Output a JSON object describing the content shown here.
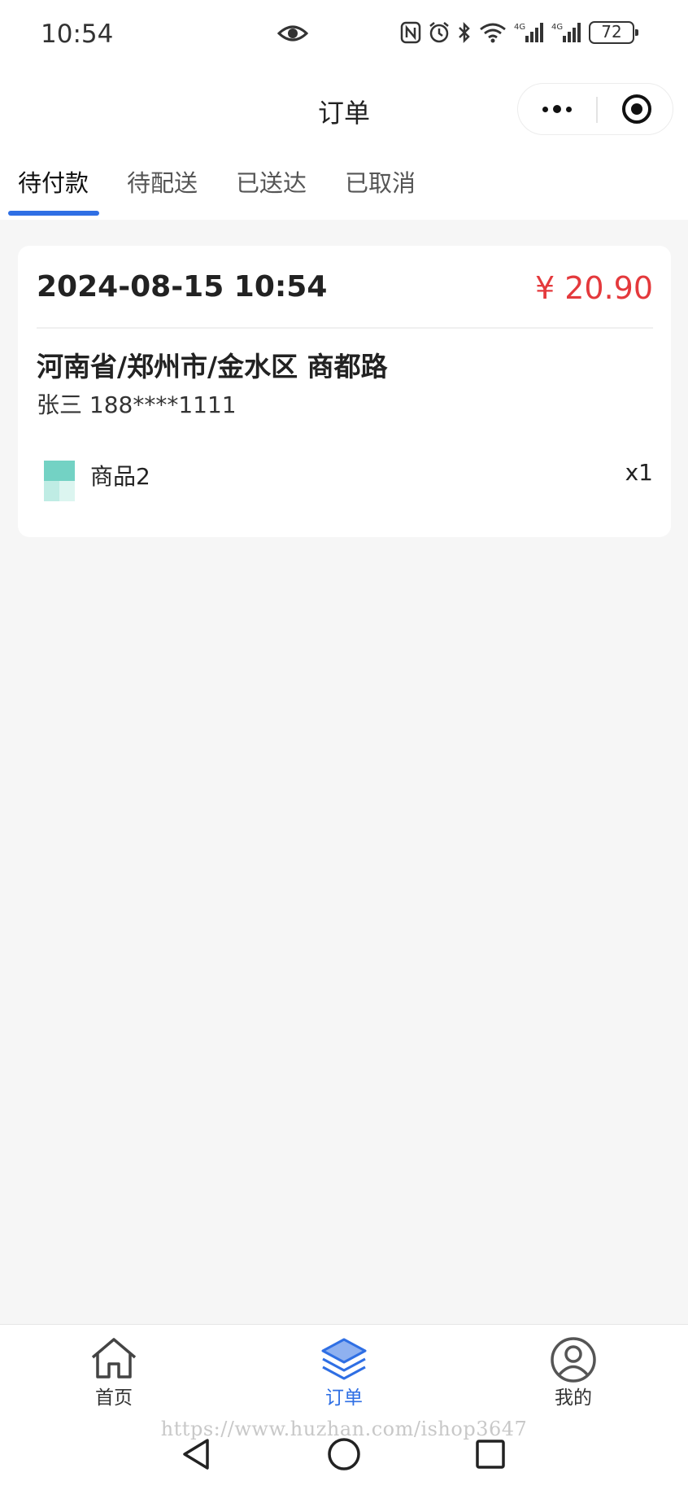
{
  "status_bar": {
    "time": "10:54",
    "battery": "72"
  },
  "nav": {
    "title": "订单"
  },
  "tabs": [
    {
      "label": "待付款",
      "active": true
    },
    {
      "label": "待配送",
      "active": false
    },
    {
      "label": "已送达",
      "active": false
    },
    {
      "label": "已取消",
      "active": false
    }
  ],
  "order": {
    "time": "2024-08-15 10:54",
    "price": "¥ 20.90",
    "address": "河南省/郑州市/金水区 商都路",
    "contact": "张三 188****1111",
    "items": [
      {
        "name": "商品2",
        "qty": "x1"
      }
    ]
  },
  "tabbar": [
    {
      "label": "首页",
      "icon": "home-icon",
      "active": false
    },
    {
      "label": "订单",
      "icon": "layers-icon",
      "active": true
    },
    {
      "label": "我的",
      "icon": "user-icon",
      "active": false
    }
  ],
  "watermark": "https://www.huzhan.com/ishop3647",
  "colors": {
    "accent": "#2f6fe4",
    "price": "#e4393c",
    "background": "#f6f6f6"
  }
}
